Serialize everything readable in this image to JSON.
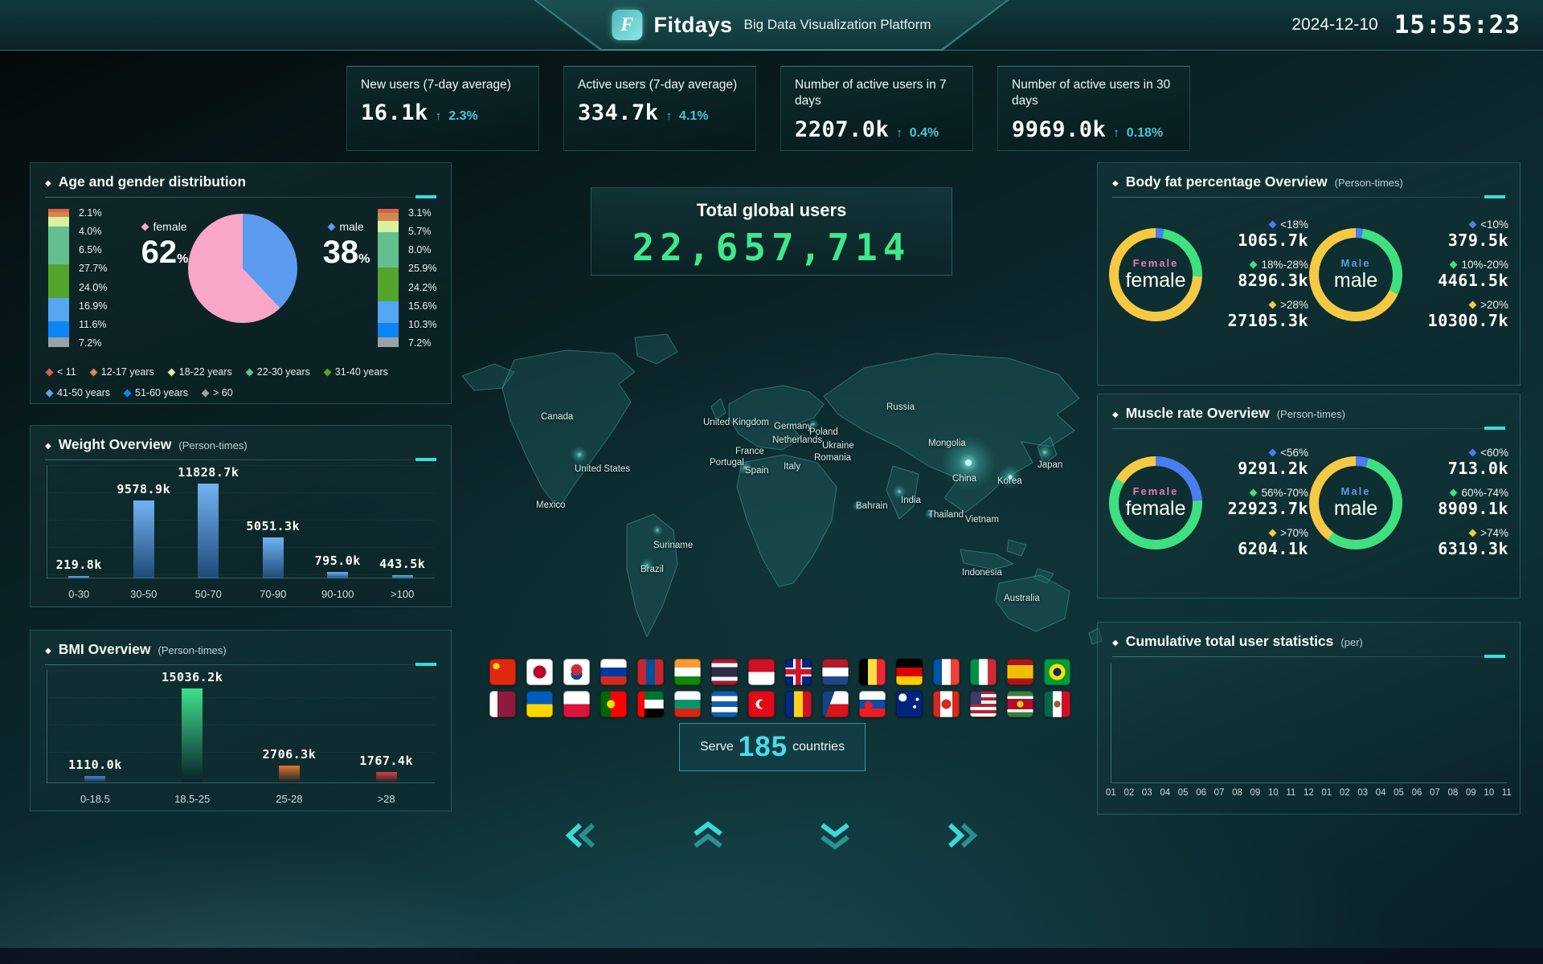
{
  "header": {
    "logo_letter": "F",
    "app_name": "Fitdays",
    "subtitle": "Big Data Visualization Platform",
    "date": "2024-12-10",
    "time": "15:55:23"
  },
  "stat_cards": [
    {
      "label": "New users (7-day average)",
      "value": "16.1k",
      "change": "2.3%"
    },
    {
      "label": "Active users (7-day average)",
      "value": "334.7k",
      "change": "4.1%"
    },
    {
      "label": "Number of active users in 7 days",
      "value": "2207.0k",
      "change": "0.4%"
    },
    {
      "label": "Number of active users in 30 days",
      "value": "9969.0k",
      "change": "0.18%"
    }
  ],
  "panels": {
    "age": {
      "title": "Age and gender distribution",
      "unit": ""
    },
    "weight": {
      "title": "Weight Overview",
      "unit": "(Person-times)"
    },
    "bmi": {
      "title": "BMI Overview",
      "unit": "(Person-times)"
    },
    "body_fat": {
      "title": "Body fat percentage Overview",
      "unit": "(Person-times)"
    },
    "muscle": {
      "title": "Muscle rate Overview",
      "unit": "(Person-times)"
    },
    "cumulative": {
      "title": "Cumulative total user statistics",
      "unit": "(per)"
    }
  },
  "total_users": {
    "label": "Total global users",
    "value": "22,657,714"
  },
  "serve": {
    "prefix": "Serve",
    "count": "185",
    "suffix": "countries"
  },
  "map_labels": [
    "Canada",
    "United States",
    "Mexico",
    "Suriname",
    "Brazil",
    "United Kingdom",
    "Germany",
    "Netherlands",
    "France",
    "Poland",
    "Ukraine",
    "Romania",
    "Portugal",
    "Spain",
    "Italy",
    "Bahrain",
    "Russia",
    "Mongolia",
    "China",
    "Korea",
    "Japan",
    "India",
    "Thailand",
    "Vietnam",
    "Indonesia",
    "Australia"
  ],
  "flags": [
    "China",
    "Japan",
    "South Korea",
    "Russia",
    "Mongolia",
    "India",
    "Thailand",
    "Indonesia",
    "United Kingdom",
    "Netherlands",
    "Belgium",
    "Germany",
    "France",
    "Italy",
    "Spain",
    "Brazil",
    "Qatar",
    "Ukraine",
    "Poland",
    "Portugal",
    "UAE",
    "Bulgaria",
    "Greece",
    "Turkey",
    "Romania",
    "Czech Republic",
    "Slovakia",
    "Australia",
    "Canada",
    "United States",
    "Suriname",
    "Mexico"
  ],
  "colors": {
    "accent_cyan": "#3bd8d8",
    "value_green": "#3fe88c",
    "female_pink": "#f9a6c9",
    "male_blue": "#5b9bf0",
    "donut_yellow": "#f6c945",
    "donut_green": "#3fe07f",
    "donut_blue": "#4a7df0"
  },
  "chart_data": [
    {
      "id": "gender_pie",
      "type": "pie",
      "title": "Age and gender distribution",
      "labels": [
        "female",
        "male"
      ],
      "values": [
        62,
        38
      ],
      "colors": [
        "#f9a6c9",
        "#5b9bf0"
      ]
    },
    {
      "id": "age_stack",
      "type": "bar",
      "stacked": true,
      "unit": "%",
      "categories": [
        "< 11",
        "12-17 years",
        "18-22 years",
        "22-30 years",
        "31-40 years",
        "41-50 years",
        "51-60 years",
        "> 60"
      ],
      "colors": [
        "#d9604a",
        "#d28a4c",
        "#d9efa2",
        "#63c08e",
        "#54a52c",
        "#54a7f0",
        "#0c85f7",
        "#9aa3a3"
      ],
      "series": [
        {
          "name": "female",
          "values": [
            2.1,
            4.0,
            6.5,
            27.7,
            24.0,
            16.9,
            11.6,
            7.2
          ]
        },
        {
          "name": "male",
          "values": [
            3.1,
            5.7,
            8.0,
            25.9,
            24.2,
            15.6,
            10.3,
            7.2
          ]
        }
      ]
    },
    {
      "id": "weight",
      "type": "bar",
      "title": "Weight Overview",
      "unit": "Person-times",
      "categories": [
        "0-30",
        "30-50",
        "50-70",
        "70-90",
        "90-100",
        ">100"
      ],
      "values": [
        219.8,
        9578.9,
        11828.7,
        5051.3,
        795.0,
        443.5
      ],
      "value_labels": [
        "219.8k",
        "9578.9k",
        "11828.7k",
        "5051.3k",
        "795.0k",
        "443.5k"
      ],
      "ylim": [
        0,
        13000
      ]
    },
    {
      "id": "bmi",
      "type": "bar",
      "title": "BMI Overview",
      "unit": "Person-times",
      "categories": [
        "0-18.5",
        "18.5-25",
        "25-28",
        ">28"
      ],
      "values": [
        1110.0,
        15036.2,
        2706.3,
        1767.4
      ],
      "value_labels": [
        "1110.0k",
        "15036.2k",
        "2706.3k",
        "1767.4k"
      ],
      "bar_colors": [
        "#4a86d8",
        "#3fe08c",
        "#e2762e",
        "#d8453c"
      ],
      "ylim": [
        0,
        16500
      ]
    },
    {
      "id": "bodyfat_female",
      "type": "donut",
      "center_top": "Female",
      "center_bottom": "female",
      "center_color": "#e87bb1",
      "segments": [
        {
          "label": "<18%",
          "value": 1065.7,
          "display": "1065.7k",
          "color": "#4a7df0"
        },
        {
          "label": "18%-28%",
          "value": 8296.3,
          "display": "8296.3k",
          "color": "#3fe07f"
        },
        {
          "label": ">28%",
          "value": 27105.3,
          "display": "27105.3k",
          "color": "#f6c945"
        }
      ]
    },
    {
      "id": "bodyfat_male",
      "type": "donut",
      "center_top": "Male",
      "center_bottom": "male",
      "center_color": "#5b9bf0",
      "segments": [
        {
          "label": "<10%",
          "value": 379.5,
          "display": "379.5k",
          "color": "#4a7df0"
        },
        {
          "label": "10%-20%",
          "value": 4461.5,
          "display": "4461.5k",
          "color": "#3fe07f"
        },
        {
          "label": ">20%",
          "value": 10300.7,
          "display": "10300.7k",
          "color": "#f6c945"
        }
      ]
    },
    {
      "id": "muscle_female",
      "type": "donut",
      "center_top": "Female",
      "center_bottom": "female",
      "center_color": "#e87bb1",
      "segments": [
        {
          "label": "<56%",
          "value": 9291.2,
          "display": "9291.2k",
          "color": "#4a7df0"
        },
        {
          "label": "56%-70%",
          "value": 22923.7,
          "display": "22923.7k",
          "color": "#3fe07f"
        },
        {
          "label": ">70%",
          "value": 6204.1,
          "display": "6204.1k",
          "color": "#f6c945"
        }
      ]
    },
    {
      "id": "muscle_male",
      "type": "donut",
      "center_top": "Male",
      "center_bottom": "male",
      "center_color": "#5b9bf0",
      "segments": [
        {
          "label": "<60%",
          "value": 713.0,
          "display": "713.0k",
          "color": "#4a7df0"
        },
        {
          "label": "60%-74%",
          "value": 8909.1,
          "display": "8909.1k",
          "color": "#3fe07f"
        },
        {
          "label": ">74%",
          "value": 6319.3,
          "display": "6319.3k",
          "color": "#f6c945"
        }
      ]
    },
    {
      "id": "cumulative",
      "type": "line",
      "title": "Cumulative total user statistics",
      "unit": "per",
      "x_labels": [
        "01",
        "02",
        "03",
        "04",
        "05",
        "06",
        "07",
        "08",
        "09",
        "10",
        "11",
        "12",
        "01",
        "02",
        "03",
        "04",
        "05",
        "06",
        "07",
        "08",
        "09",
        "10",
        "11"
      ],
      "series": []
    }
  ]
}
